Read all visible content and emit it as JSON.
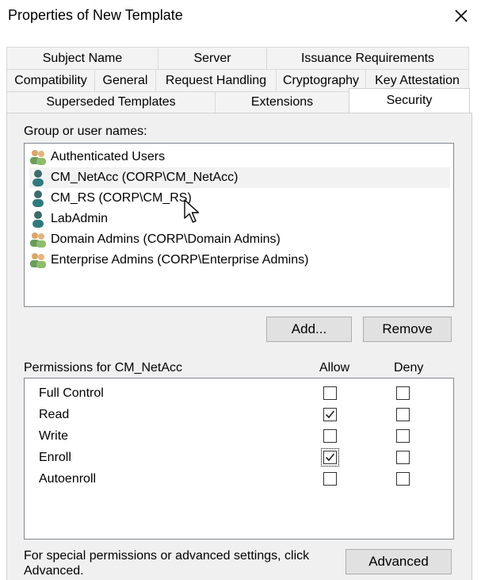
{
  "window": {
    "title": "Properties of New Template"
  },
  "tabs": {
    "row1": [
      "Subject Name",
      "Server",
      "Issuance Requirements"
    ],
    "row2": [
      "Compatibility",
      "General",
      "Request Handling",
      "Cryptography",
      "Key Attestation"
    ],
    "row3": [
      "Superseded Templates",
      "Extensions",
      "Security"
    ],
    "active": "Security"
  },
  "security": {
    "group_label": "Group or user names:",
    "users": [
      {
        "name": "Authenticated Users",
        "icon": "user-group-icon",
        "selected": false
      },
      {
        "name": "CM_NetAcc (CORP\\CM_NetAcc)",
        "icon": "user-icon",
        "selected": true
      },
      {
        "name": "CM_RS (CORP\\CM_RS)",
        "icon": "user-icon",
        "selected": false
      },
      {
        "name": "LabAdmin",
        "icon": "user-icon",
        "selected": false
      },
      {
        "name": "Domain Admins (CORP\\Domain Admins)",
        "icon": "user-group-icon",
        "selected": false
      },
      {
        "name": "Enterprise Admins (CORP\\Enterprise Admins)",
        "icon": "user-group-icon",
        "selected": false
      }
    ],
    "add_label": "Add...",
    "remove_label": "Remove",
    "permissions_label": "Permissions for CM_NetAcc",
    "allow_header": "Allow",
    "deny_header": "Deny",
    "permissions": [
      {
        "name": "Full Control",
        "allow": false,
        "deny": false
      },
      {
        "name": "Read",
        "allow": true,
        "deny": false
      },
      {
        "name": "Write",
        "allow": false,
        "deny": false
      },
      {
        "name": "Enroll",
        "allow": true,
        "deny": false
      },
      {
        "name": "Autoenroll",
        "allow": false,
        "deny": false
      }
    ],
    "advanced_text_line1": "For special permissions or advanced settings, click",
    "advanced_text_line2": "Advanced.",
    "advanced_label": "Advanced"
  }
}
